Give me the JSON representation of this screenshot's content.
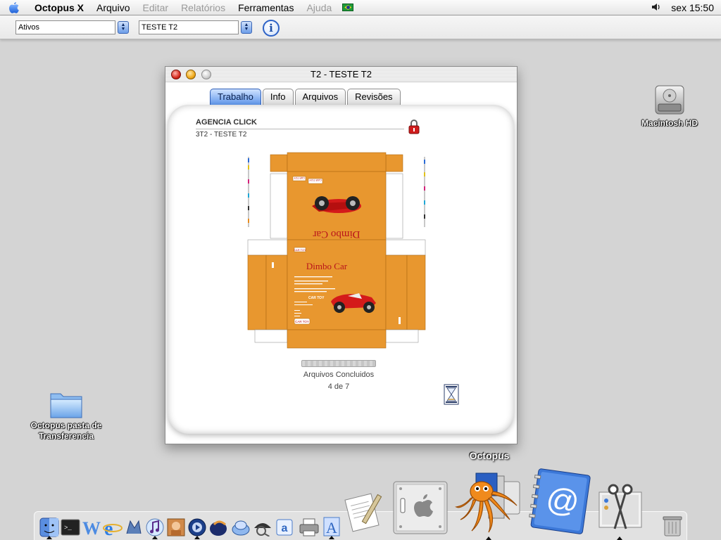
{
  "menubar": {
    "app_name": "Octopus X",
    "items": [
      "Arquivo",
      "Editar",
      "Relatórios",
      "Ferramentas",
      "Ajuda"
    ],
    "disabled": [
      false,
      true,
      true,
      false,
      true
    ],
    "clock": "sex 15:50"
  },
  "toolbar": {
    "status_filter": "Ativos",
    "job_filter": "TESTE T2"
  },
  "desktop": {
    "hd_label": "Macintosh HD",
    "folder_label_line1": "Octopus pasta de",
    "folder_label_line2": "Transferencia"
  },
  "window": {
    "title": "T2 - TESTE T2",
    "tabs": [
      "Trabalho",
      "Info",
      "Arquivos",
      "Revisões"
    ],
    "active_tab": 0,
    "client": "AGENCIA CLICK",
    "job": "3T2 - TESTE T2",
    "status_label": "Arquivos Concluidos",
    "status_count": "4 de 7",
    "artwork": {
      "product_name": "Dimbo Car",
      "product_tag": "CAR TOY",
      "box_color": "#e8972f"
    }
  },
  "dock": {
    "hover_label": "Octopus"
  },
  "colors": {
    "desktop": "#d4d4d4",
    "aqua_blue": "#5f96ea",
    "box_orange": "#e8972f",
    "car_red": "#d41a1a"
  }
}
